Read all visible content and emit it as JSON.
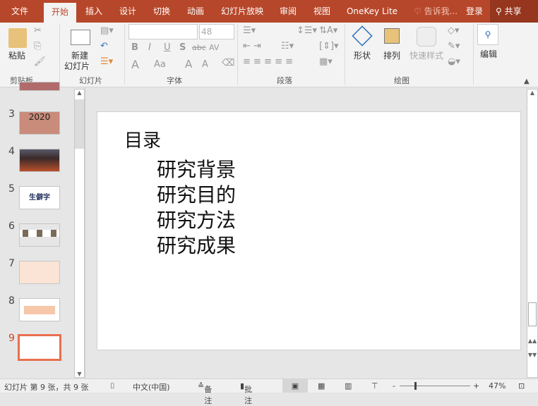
{
  "tabs": [
    "文件",
    "开始",
    "插入",
    "设计",
    "切换",
    "动画",
    "幻灯片放映",
    "审阅",
    "视图",
    "OneKey Lite"
  ],
  "active_tab": "开始",
  "tell_me": "告诉我...",
  "login": "登录",
  "share": "共享",
  "ribbon": {
    "clipboard": {
      "paste": "粘贴",
      "label": "剪贴板"
    },
    "slides": {
      "new_slide_1": "新建",
      "new_slide_2": "幻灯片",
      "label": "幻灯片"
    },
    "font": {
      "font_name": "",
      "font_size": "48",
      "bold": "B",
      "italic": "I",
      "underline": "U",
      "shadow": "S",
      "strike": "abc",
      "spacing": "AV",
      "color": "A",
      "case": "Aa",
      "grow": "A",
      "shrink": "A",
      "label": "字体"
    },
    "paragraph": {
      "label": "段落"
    },
    "drawing": {
      "shapes": "形状",
      "arrange": "排列",
      "quick_styles": "快速样式",
      "label": "绘图"
    },
    "editing": {
      "label": "编辑"
    }
  },
  "thumbnails": [
    {
      "num": "3",
      "text": "2020",
      "bg": "#c98b7a"
    },
    {
      "num": "4",
      "text": "",
      "bg": "#3a3a44"
    },
    {
      "num": "5",
      "text": "生僻字",
      "bg": "#ffffff"
    },
    {
      "num": "6",
      "text": "",
      "bg": "#ffffff"
    },
    {
      "num": "7",
      "text": "",
      "bg": "#fbe4d5"
    },
    {
      "num": "8",
      "text": "",
      "bg": "#ffffff"
    },
    {
      "num": "9",
      "text": "",
      "bg": "#ffffff"
    }
  ],
  "selected_slide": "9",
  "slide": {
    "title": "目录",
    "items": [
      "研究背景",
      "研究目的",
      "研究方法",
      "研究成果"
    ]
  },
  "status": {
    "slide_info": "幻灯片 第 9 张，共 9 张",
    "language": "中文(中国)",
    "notes": "备注",
    "comments": "批注",
    "zoom": "47%"
  },
  "colors": {
    "accent": "#b7472a",
    "selected": "#e8704f"
  }
}
